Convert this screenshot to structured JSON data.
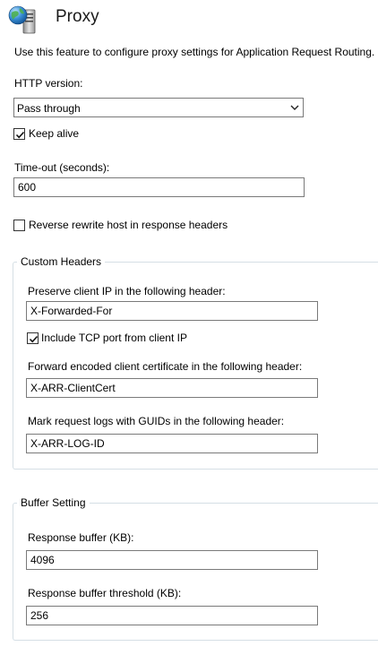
{
  "header": {
    "title": "Proxy",
    "icon": "globe-server-icon"
  },
  "description": "Use this feature to configure proxy settings for Application Request Routing.",
  "http_version": {
    "label": "HTTP version:",
    "selected": "Pass through"
  },
  "keep_alive": {
    "label": "Keep alive",
    "checked": true
  },
  "timeout": {
    "label": "Time-out (seconds):",
    "value": "600"
  },
  "reverse_rewrite": {
    "label": "Reverse rewrite host in response headers",
    "checked": false
  },
  "custom_headers": {
    "title": "Custom Headers",
    "preserve_ip_label": "Preserve client IP in the following header:",
    "preserve_ip_value": "X-Forwarded-For",
    "include_tcp_label": "Include TCP port from client IP",
    "include_tcp_checked": true,
    "client_cert_label": "Forward encoded client certificate in the following header:",
    "client_cert_value": "X-ARR-ClientCert",
    "log_guid_label": "Mark request logs with GUIDs in the following header:",
    "log_guid_value": "X-ARR-LOG-ID"
  },
  "buffer_setting": {
    "title": "Buffer Setting",
    "response_buffer_label": "Response buffer (KB):",
    "response_buffer_value": "4096",
    "threshold_label": "Response buffer threshold (KB):",
    "threshold_value": "256"
  },
  "colors": {
    "group_border": "#d5dfe5",
    "input_border": "#7a7a7a"
  }
}
